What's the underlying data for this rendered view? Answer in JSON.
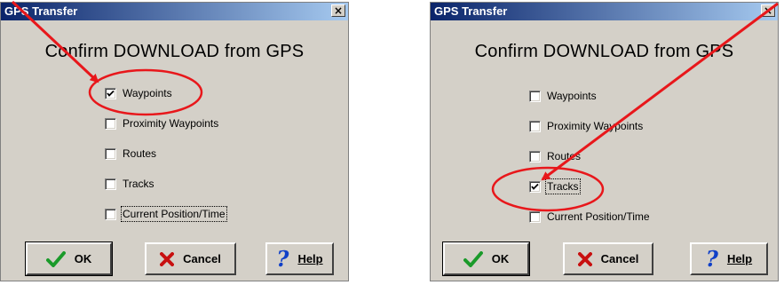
{
  "dialogs": [
    {
      "title": "GPS Transfer",
      "close_glyph": "×",
      "heading": "Confirm DOWNLOAD from GPS",
      "options": [
        {
          "label": "Waypoints",
          "checked": true
        },
        {
          "label": "Proximity Waypoints",
          "checked": false
        },
        {
          "label": "Routes",
          "checked": false
        },
        {
          "label": "Tracks",
          "checked": false
        },
        {
          "label": "Current Position/Time",
          "checked": false
        }
      ],
      "buttons": {
        "ok": "OK",
        "cancel": "Cancel",
        "help": "Help"
      }
    },
    {
      "title": "GPS Transfer",
      "close_glyph": "×",
      "heading": "Confirm DOWNLOAD from GPS",
      "options": [
        {
          "label": "Waypoints",
          "checked": false
        },
        {
          "label": "Proximity Waypoints",
          "checked": false
        },
        {
          "label": "Routes",
          "checked": false
        },
        {
          "label": "Tracks",
          "checked": true
        },
        {
          "label": "Current Position/Time",
          "checked": false
        }
      ],
      "buttons": {
        "ok": "OK",
        "cancel": "Cancel",
        "help": "Help"
      }
    }
  ],
  "annotation_color": "#e8171b",
  "icons": {
    "ok": "checkmark-icon",
    "cancel": "x-icon",
    "help": "question-icon"
  }
}
